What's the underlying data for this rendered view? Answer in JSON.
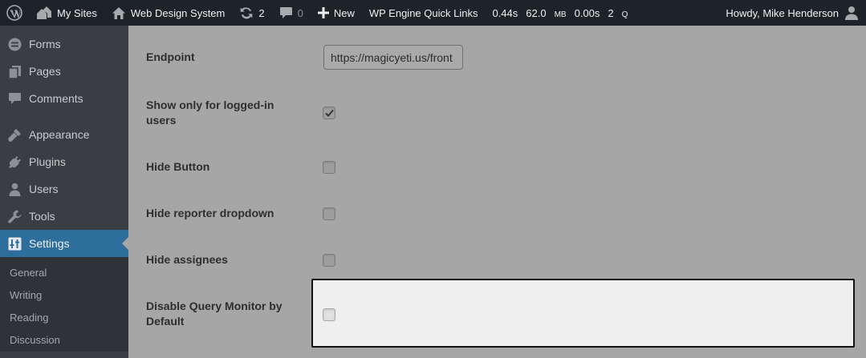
{
  "adminbar": {
    "my_sites": "My Sites",
    "site_name": "Web Design System",
    "updates_count": "2",
    "comments_count": "0",
    "new_label": "New",
    "quick_links": "WP Engine Quick Links",
    "qm": {
      "time": "0.44s",
      "memory": "62.0",
      "memory_unit": "MB",
      "db_time": "0.00s",
      "queries": "2",
      "queries_unit": "Q"
    },
    "howdy": "Howdy, Mike Henderson"
  },
  "sidebar": {
    "items": [
      {
        "label": "Forms",
        "icon": "forms-icon"
      },
      {
        "label": "Pages",
        "icon": "pages-icon"
      },
      {
        "label": "Comments",
        "icon": "comments-icon"
      },
      {
        "label": "Appearance",
        "icon": "appearance-icon"
      },
      {
        "label": "Plugins",
        "icon": "plugins-icon"
      },
      {
        "label": "Users",
        "icon": "users-icon"
      },
      {
        "label": "Tools",
        "icon": "tools-icon"
      },
      {
        "label": "Settings",
        "icon": "settings-icon",
        "current": true
      }
    ],
    "submenu": [
      "General",
      "Writing",
      "Reading",
      "Discussion"
    ]
  },
  "settings": {
    "endpoint": {
      "label": "Endpoint",
      "value": "https://magicyeti.us/front"
    },
    "logged_in": {
      "label": "Show only for logged-in users",
      "checked": true
    },
    "hide_button": {
      "label": "Hide Button",
      "checked": false
    },
    "hide_reporter": {
      "label": "Hide reporter dropdown",
      "checked": false
    },
    "hide_assignees": {
      "label": "Hide assignees",
      "checked": false
    },
    "disable_qm": {
      "label": "Disable Query Monitor by Default",
      "checked": false
    }
  },
  "colors": {
    "adminbar": "#1d2327",
    "sidebar": "#3a3e42",
    "accent": "#2d6e9d",
    "content": "#a6a6a6",
    "highlight": "#efefef"
  }
}
